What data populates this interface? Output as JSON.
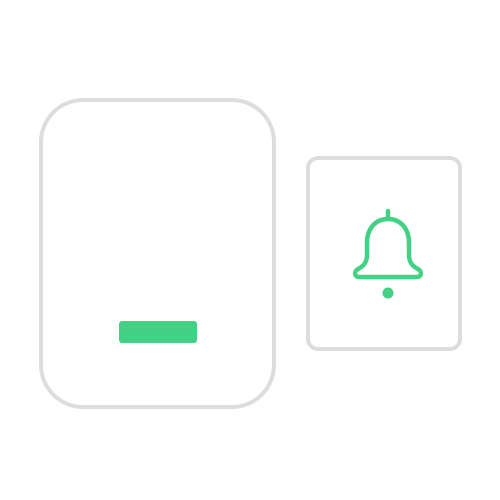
{
  "colors": {
    "device_outline": "#dddddd",
    "accent_green": "#43d185",
    "background": "#ffffff"
  },
  "devices": {
    "receiver": {
      "label": "",
      "indicator": "indicator-light"
    },
    "transmitter": {
      "label": "",
      "icon": "bell-icon"
    }
  }
}
